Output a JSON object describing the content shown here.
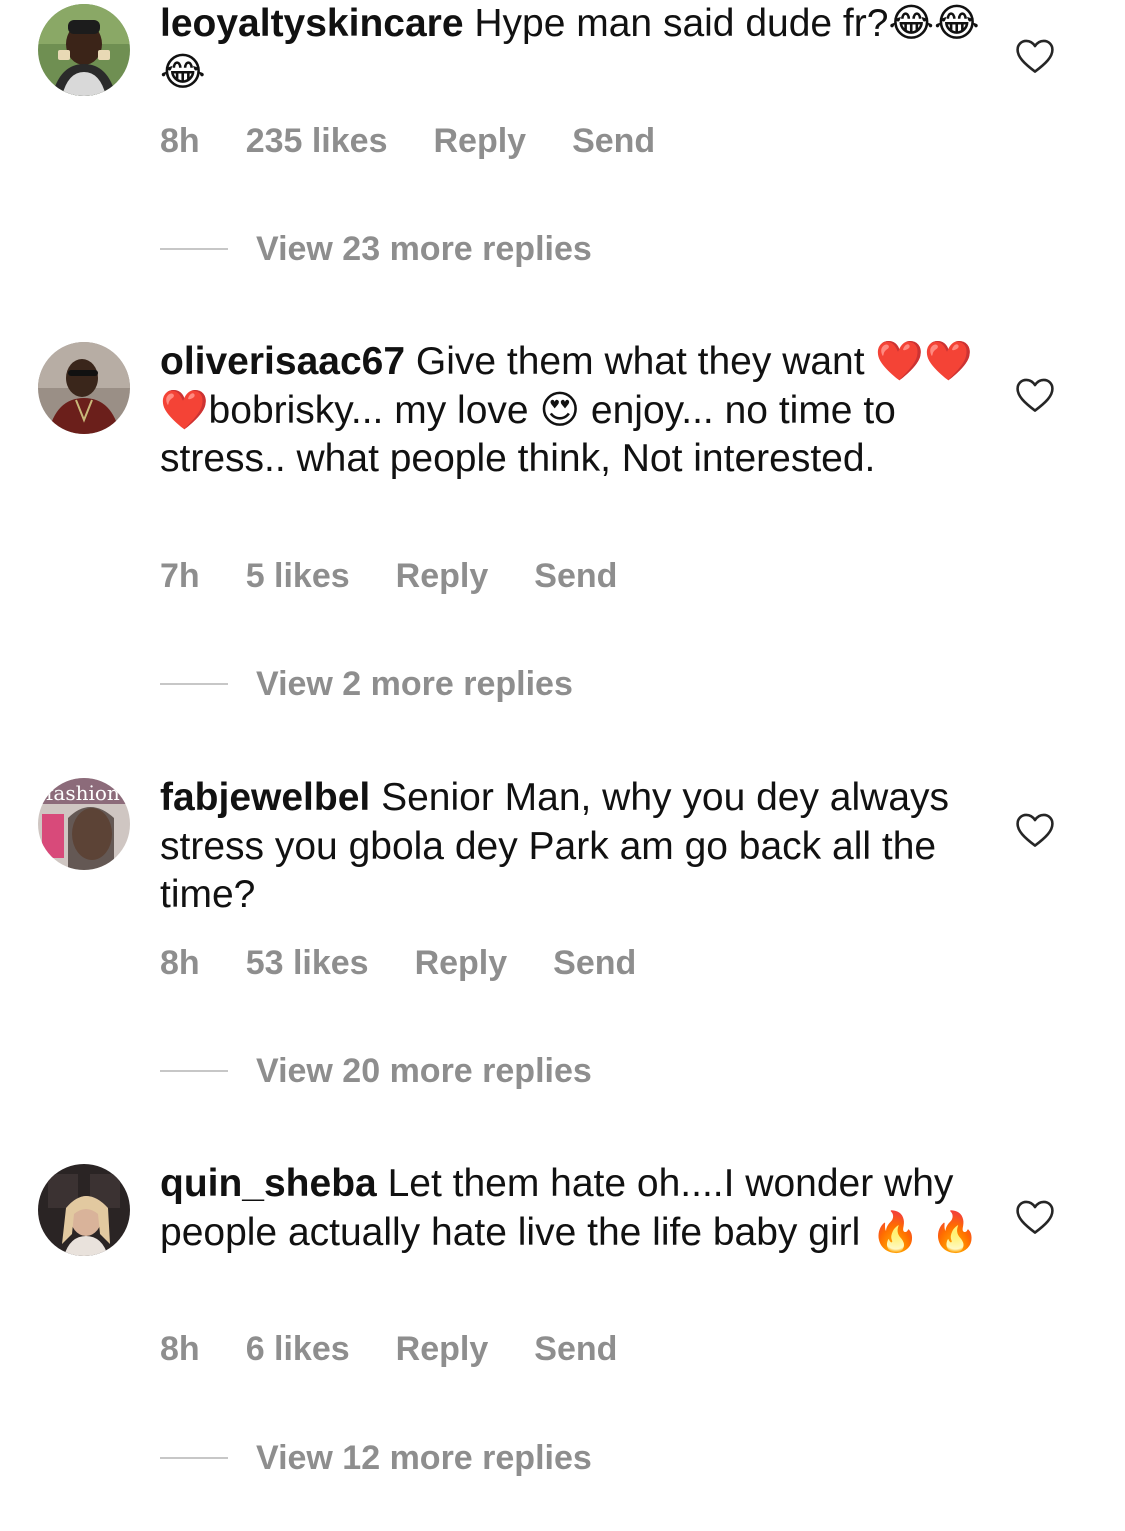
{
  "comments": [
    {
      "username": "leoyaltyskincare",
      "text": "Hype man said dude fr?😂😂😂",
      "time": "8h",
      "likes": "235 likes",
      "reply": "Reply",
      "send": "Send",
      "view_replies": "View 23 more replies"
    },
    {
      "username": "oliverisaac67",
      "text": "Give them what they want ❤️❤️❤️bobrisky... my love 😍 enjoy... no time to stress.. what people think, Not interested.",
      "time": "7h",
      "likes": "5 likes",
      "reply": "Reply",
      "send": "Send",
      "view_replies": "View 2 more replies"
    },
    {
      "username": "fabjewelbel",
      "text": "Senior Man, why you dey always stress you gbola dey Park am go back all the time?",
      "time": "8h",
      "likes": "53 likes",
      "reply": "Reply",
      "send": "Send",
      "view_replies": "View 20 more replies",
      "avatar_text": "fashion"
    },
    {
      "username": "quin_sheba",
      "text": "Let them hate  oh....I wonder why people actually hate live the life baby girl 🔥 🔥",
      "time": "8h",
      "likes": "6 likes",
      "reply": "Reply",
      "send": "Send",
      "view_replies": "View 12 more replies"
    }
  ],
  "colors": {
    "text": "#111111",
    "muted": "#8e8e8e",
    "divider": "#c7c7c7",
    "heart_outline": "#262626"
  },
  "icons": {
    "like": "heart-outline-icon"
  }
}
